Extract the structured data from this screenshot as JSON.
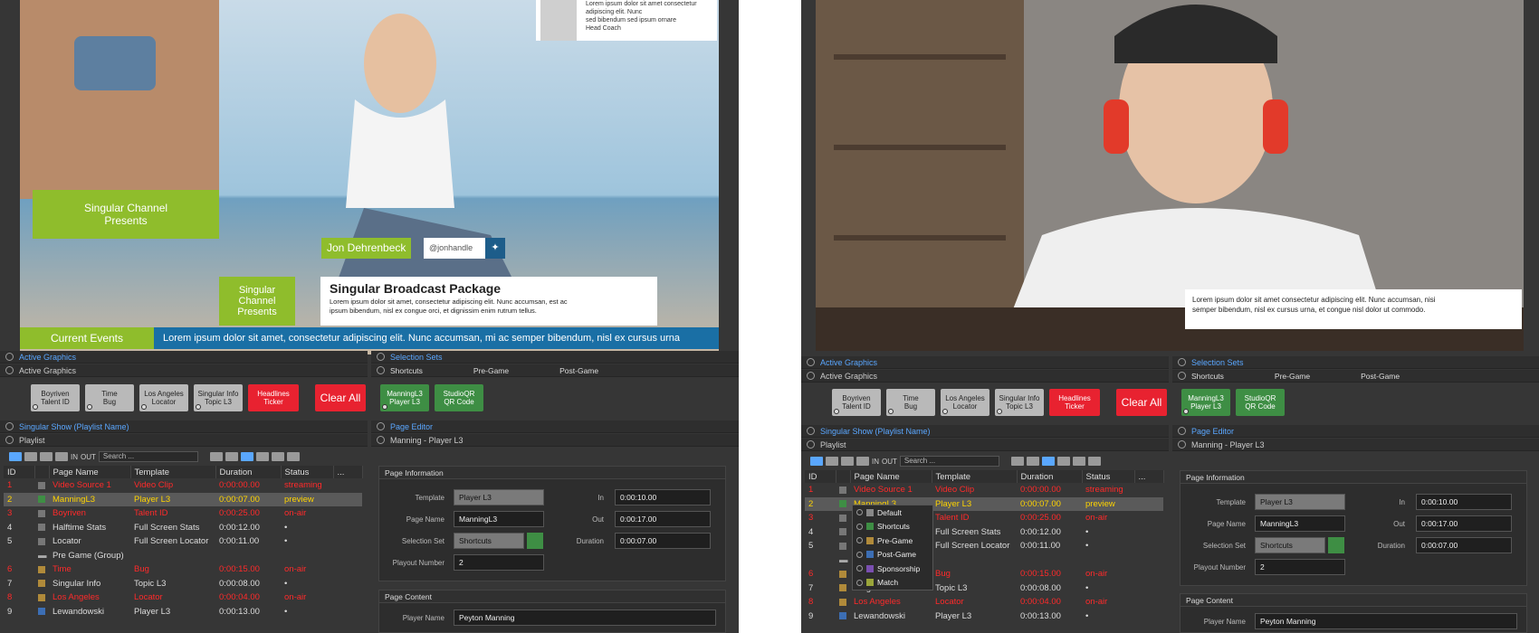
{
  "left": {
    "preview": {
      "l3_left_label": "Singular Channel\nPresents",
      "name_tag": "Jon Dehrenbeck",
      "handle": "@jonhandle",
      "side_note": "Lorem ipsum dolor sit amet consectetur adipiscing elit. Nunc\nsed bibendum sed ipsum ornare\nHead Coach",
      "l3_presents": "Singular Channel\nPresents",
      "package_title": "Singular Broadcast Package",
      "package_body": "Lorem ipsum dolor sit amet, consectetur adipiscing elit. Nunc accumsan, est ac\nipsum bibendum, nisl ex congue orci, et dignissim enim rutrum tellus.",
      "ticker_label": "Current Events",
      "ticker_text": "Lorem ipsum dolor sit amet, consectetur adipiscing elit. Nunc accumsan, mi ac semper bibendum, nisl ex cursus urna"
    }
  },
  "right": {
    "preview": {
      "caption": "Lorem ipsum dolor sit amet consectetur adipiscing elit. Nunc accumsan, nisi\nsemper bibendum, nisl ex cursus urna, et congue nisl dolor ut commodo."
    }
  },
  "panels": {
    "active_graphics_tab": "Active Graphics",
    "active_graphics_sub": "Active Graphics",
    "selection_sets_tab": "Selection Sets",
    "sets": [
      "Shortcuts",
      "Pre-Game",
      "Post-Game"
    ],
    "playlist_tab": "Singular Show (Playlist Name)",
    "playlist_sub": "Playlist",
    "page_editor_tab": "Page Editor",
    "page_editor_sub": "Manning - Player L3"
  },
  "active_buttons": [
    {
      "label": "Boyriven\nTalent ID",
      "color": "gray"
    },
    {
      "label": "Time\nBug",
      "color": "gray"
    },
    {
      "label": "Los Angeles\nLocator",
      "color": "gray"
    },
    {
      "label": "Singular Info\nTopic L3",
      "color": "gray"
    },
    {
      "label": "Headlines\nTicker",
      "color": "red"
    }
  ],
  "clear_all": "Clear All",
  "shortcut_buttons": [
    {
      "label": "ManningL3\nPlayer L3"
    },
    {
      "label": "StudioQR\nQR Code"
    }
  ],
  "toolbar": {
    "in": "IN",
    "out": "OUT",
    "search_placeholder": "Search ..."
  },
  "playlist": {
    "columns": [
      "ID",
      "Page Name",
      "Template",
      "Duration",
      "Status",
      "..."
    ],
    "rows": [
      {
        "id": "1",
        "name": "Video Source 1",
        "template": "Video Clip",
        "duration": "0:00:00.00",
        "status": "streaming",
        "style": "red",
        "swatch": "#777777"
      },
      {
        "id": "2",
        "name": "ManningL3",
        "template": "Player L3",
        "duration": "0:00:07.00",
        "status": "preview",
        "style": "yel",
        "swatch": "#3e8e44"
      },
      {
        "id": "3",
        "name": "Boyriven",
        "template": "Talent ID",
        "duration": "0:00:25.00",
        "status": "on-air",
        "style": "red",
        "swatch": "#777777"
      },
      {
        "id": "4",
        "name": "Halftime Stats",
        "template": "Full Screen Stats",
        "duration": "0:00:12.00",
        "status": "•",
        "style": "",
        "swatch": "#777777"
      },
      {
        "id": "5",
        "name": "Locator",
        "template": "Full Screen Locator",
        "duration": "0:00:11.00",
        "status": "•",
        "style": "",
        "swatch": "#777777"
      },
      {
        "id": "",
        "name": "Pre Game (Group)",
        "template": "",
        "duration": "",
        "status": "",
        "style": "",
        "swatch": ""
      },
      {
        "id": "6",
        "name": "Time",
        "template": "Bug",
        "duration": "0:00:15.00",
        "status": "on-air",
        "style": "red",
        "swatch": "#b08a3a"
      },
      {
        "id": "7",
        "name": "Singular Info",
        "template": "Topic L3",
        "duration": "0:00:08.00",
        "status": "•",
        "style": "",
        "swatch": "#b08a3a"
      },
      {
        "id": "8",
        "name": "Los Angeles",
        "template": "Locator",
        "duration": "0:00:04.00",
        "status": "on-air",
        "style": "red",
        "swatch": "#b08a3a"
      },
      {
        "id": "9",
        "name": "Lewandowski",
        "template": "Player L3",
        "duration": "0:00:13.00",
        "status": "•",
        "style": "",
        "swatch": "#3c6eb4"
      }
    ]
  },
  "page_info": {
    "header": "Page Information",
    "template_label": "Template",
    "template_value": "Player L3",
    "page_name_label": "Page Name",
    "page_name_value": "ManningL3",
    "selection_set_label": "Selection Set",
    "selection_set_value": "Shortcuts",
    "playout_label": "Playout Number",
    "playout_value": "2",
    "in_label": "In",
    "in_value": "0:00:10.00",
    "out_label": "Out",
    "out_value": "0:00:17.00",
    "duration_label": "Duration",
    "duration_value": "0:00:07.00"
  },
  "page_content": {
    "header": "Page Content",
    "player_label": "Player Name",
    "player_value": "Peyton Manning"
  },
  "context_menu": {
    "items": [
      {
        "label": "Default",
        "color": "#888888"
      },
      {
        "label": "Shortcuts",
        "color": "#3e8e44"
      },
      {
        "label": "Pre-Game",
        "color": "#b08a3a"
      },
      {
        "label": "Post-Game",
        "color": "#3c6eb4"
      },
      {
        "label": "Sponsorship",
        "color": "#7a4fb0"
      },
      {
        "label": "Match",
        "color": "#9aa53a"
      }
    ]
  },
  "colors": {
    "accent_blue": "#5aa7ff",
    "on_air_red": "#ff2a2a",
    "preview_yellow": "#ffd400",
    "panel": "#363636"
  }
}
